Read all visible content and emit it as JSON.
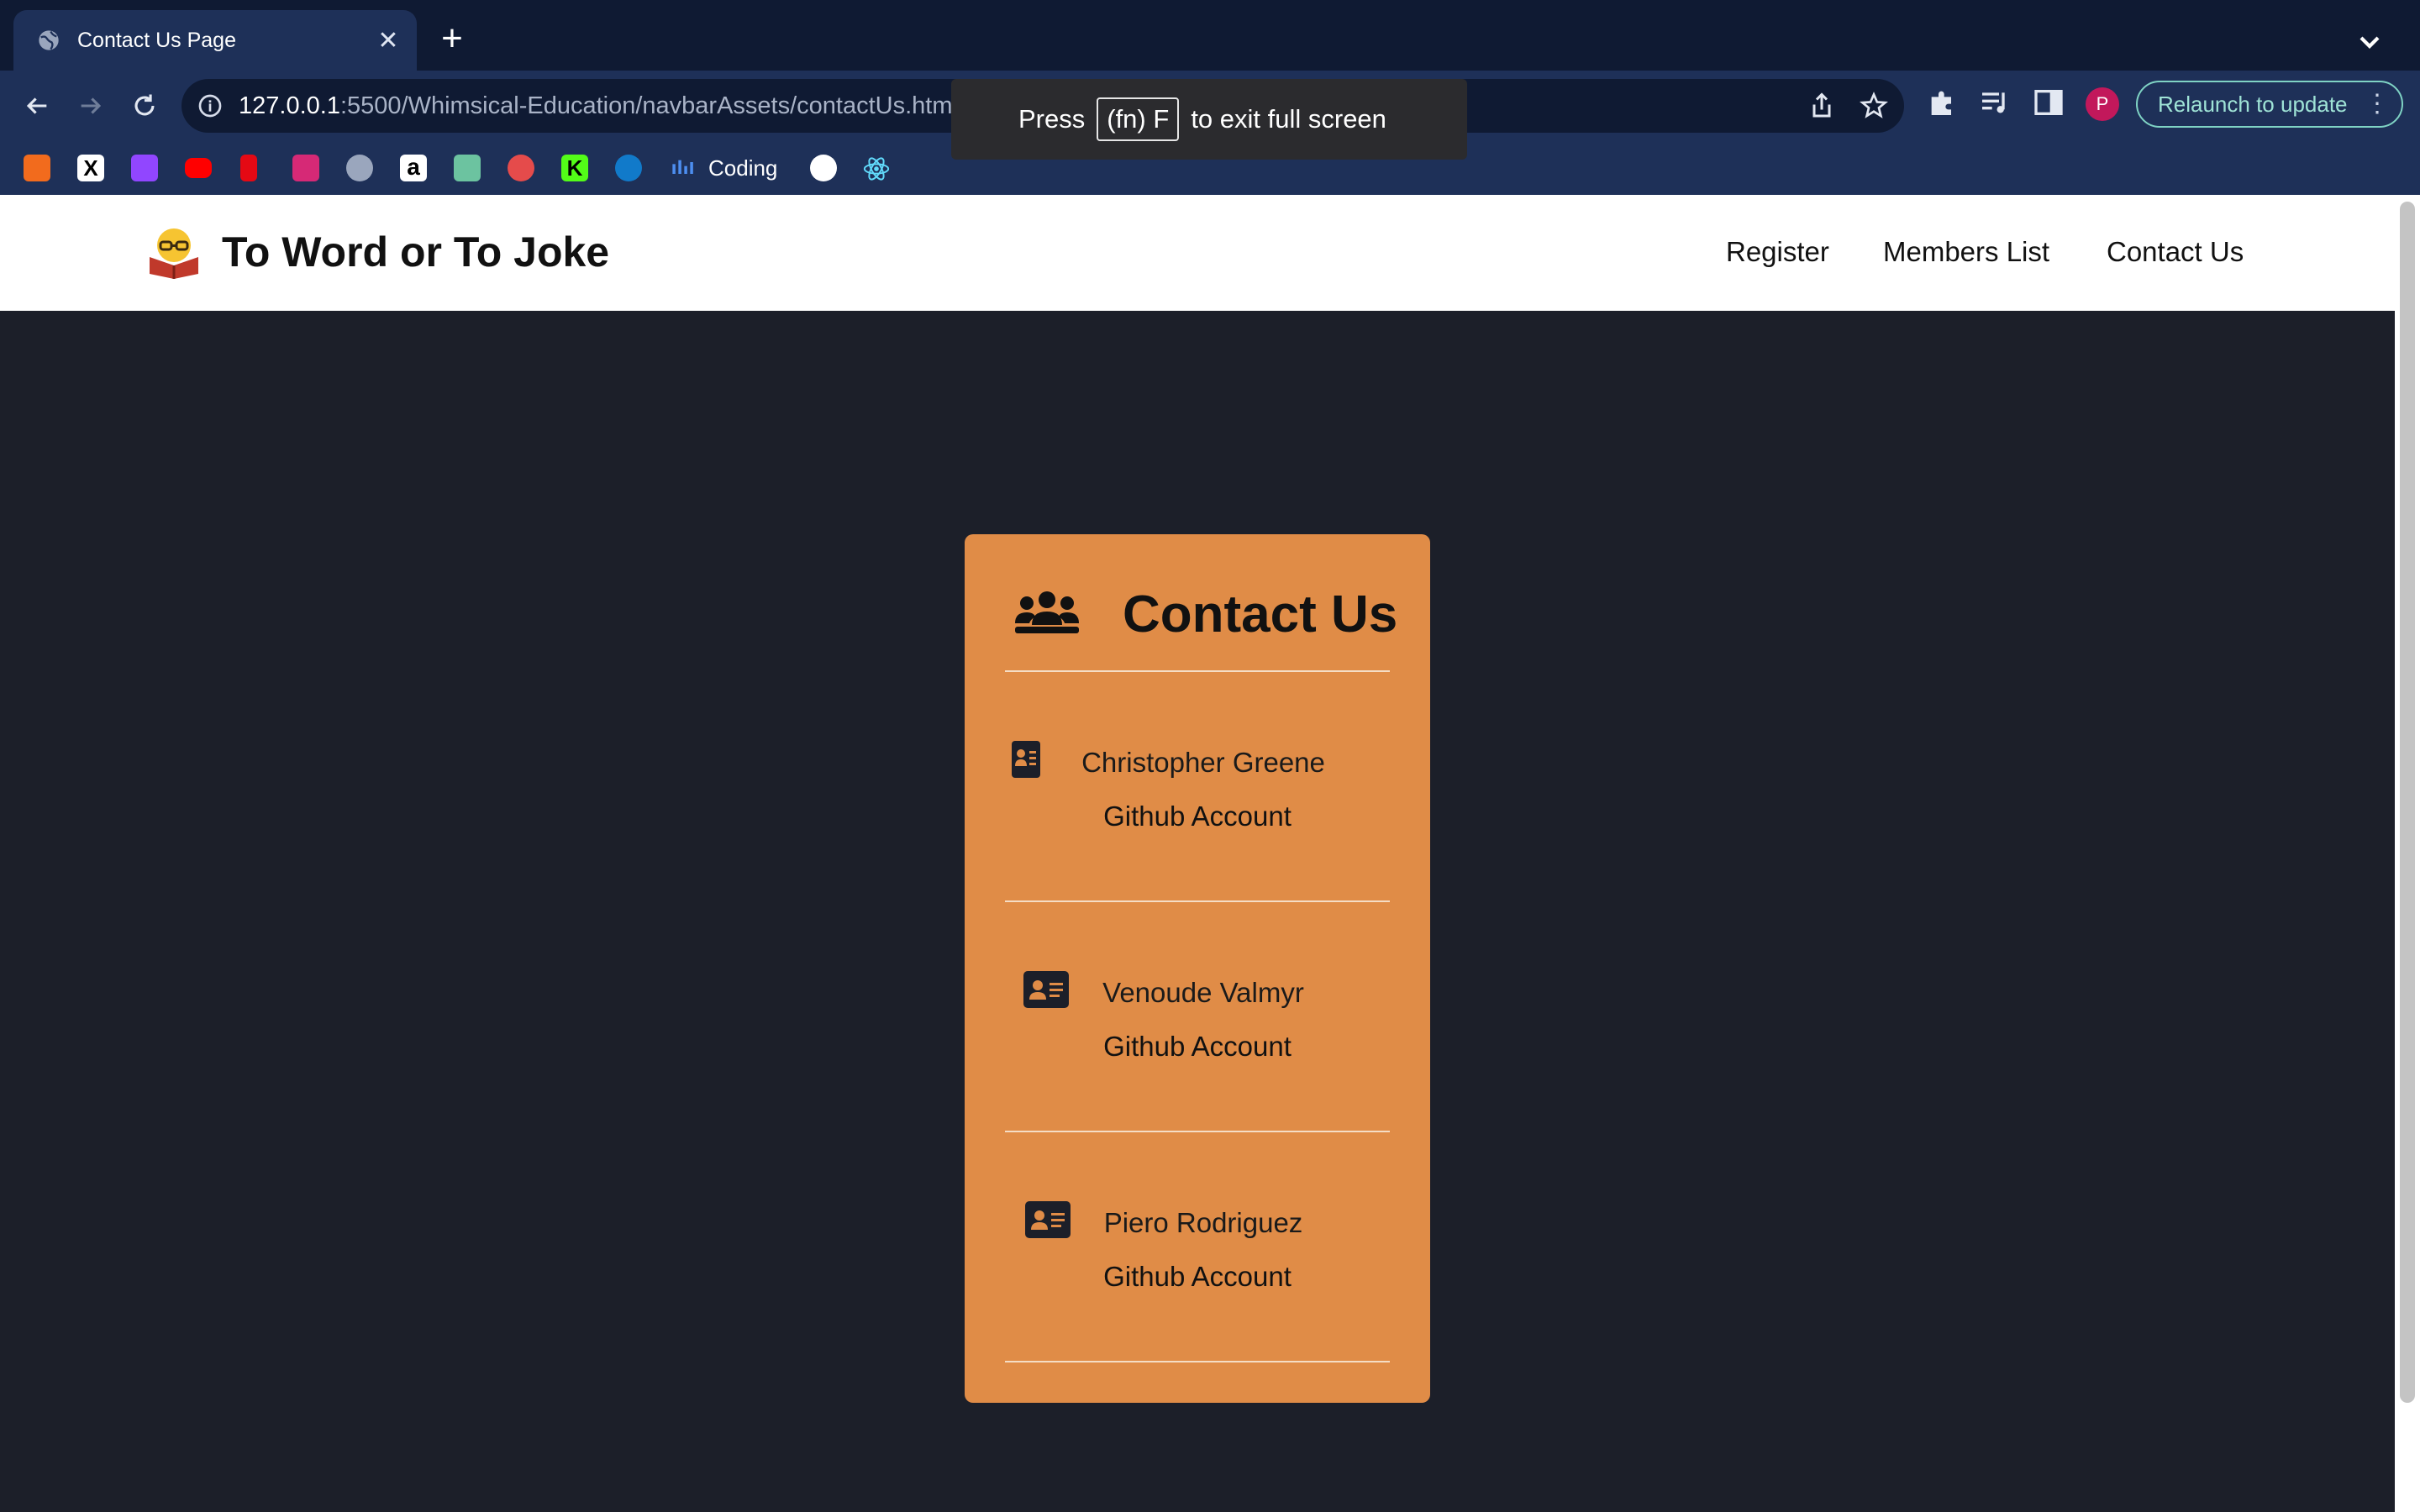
{
  "browser": {
    "tab_title": "Contact Us Page",
    "url_host": "127.0.0.1",
    "url_rest": ":5500/Whimsical-Education/navbarAssets/contactUs.html",
    "relaunch_label": "Relaunch to update",
    "profile_initial": "P",
    "bookmark_label": "Coding",
    "fullscreen_toast": {
      "press": "Press",
      "key": "(fn) F",
      "rest": "to exit full screen"
    }
  },
  "site": {
    "brand": "To Word or To Joke",
    "nav": [
      "Register",
      "Members List",
      "Contact Us"
    ]
  },
  "contact": {
    "title": "Contact Us",
    "members": [
      {
        "name": "Christopher Greene",
        "link": "Github Account"
      },
      {
        "name": "Venoude Valmyr",
        "link": "Github Account"
      },
      {
        "name": "Piero Rodriguez",
        "link": "Github Account"
      }
    ]
  },
  "colors": {
    "page_bg": "#1c1f29",
    "card_bg": "#e08c47",
    "chrome_bg": "#1e3058"
  }
}
